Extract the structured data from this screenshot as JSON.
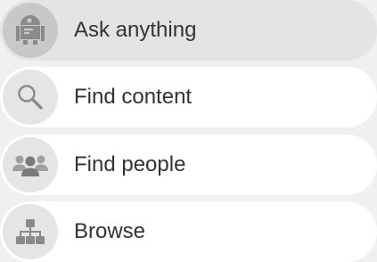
{
  "menu": {
    "items": [
      {
        "label": "Ask anything",
        "icon": "robot-icon",
        "selected": true
      },
      {
        "label": "Find content",
        "icon": "search-icon",
        "selected": false
      },
      {
        "label": "Find people",
        "icon": "people-icon",
        "selected": false
      },
      {
        "label": "Browse",
        "icon": "sitemap-icon",
        "selected": false
      }
    ]
  },
  "colors": {
    "background": "#f0f0f0",
    "item_background": "#ffffff",
    "item_selected_background": "#e4e4e4",
    "icon_circle": "#e5e5e5",
    "icon_circle_selected": "#c8c8c8",
    "icon_glyph": "#8a8a8a",
    "text": "#333333"
  }
}
